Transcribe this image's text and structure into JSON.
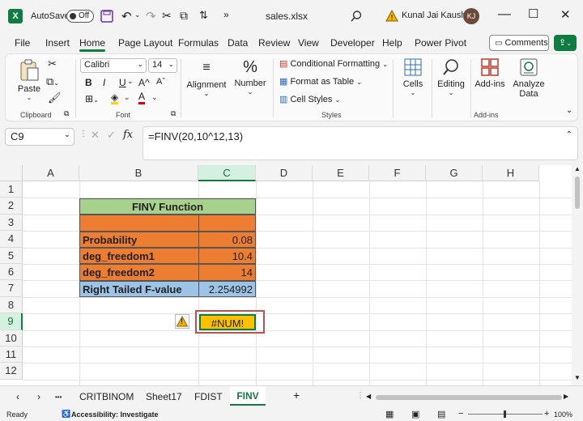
{
  "titlebar": {
    "app_icon": "excel-icon",
    "autosave_label": "AutoSave",
    "autosave_state": "Off",
    "filename": "sales.xlsx",
    "user_name": "Kunal Jai Kaushik",
    "user_initials": "KJ"
  },
  "menu_tabs": [
    "File",
    "Insert",
    "Home",
    "Page Layout",
    "Formulas",
    "Data",
    "Review",
    "View",
    "Developer",
    "Help",
    "Power Pivot"
  ],
  "active_tab": "Home",
  "comments_label": "Comments",
  "ribbon": {
    "paste_label": "Paste",
    "clipboard_label": "Clipboard",
    "font_name": "Calibri",
    "font_size": "14",
    "bold": "B",
    "italic": "I",
    "underline": "U",
    "font_label": "Font",
    "alignment_label": "Alignment",
    "number_label": "Number",
    "cond_format_label": "Conditional Formatting",
    "format_table_label": "Format as Table",
    "cell_styles_label": "Cell Styles",
    "styles_label": "Styles",
    "cells_label": "Cells",
    "editing_label": "Editing",
    "addins_label": "Add-ins",
    "analyze_label_1": "Analyze",
    "analyze_label_2": "Data",
    "addins_group_label": "Add-ins",
    "a_glyph": "A"
  },
  "formula_bar": {
    "name_box": "C9",
    "fx_label": "fx",
    "formula": "=FINV(20,10^12,13)"
  },
  "columns": [
    "A",
    "B",
    "C",
    "D",
    "E",
    "F",
    "G",
    "H"
  ],
  "rows": [
    "1",
    "2",
    "3",
    "4",
    "5",
    "6",
    "7",
    "8",
    "9",
    "10",
    "11",
    "12"
  ],
  "sheet": {
    "header": "FINV Function",
    "labels": [
      "Probability",
      "deg_freedom1",
      "deg_freedom2",
      "Right Tailed F-value"
    ],
    "values": [
      "0.08",
      "10.4",
      "14",
      "2.254992"
    ],
    "error_value": "#NUM!",
    "warning_glyph": "!"
  },
  "sheet_tabs": [
    "CRITBINOM",
    "Sheet17",
    "FDIST",
    "FINV"
  ],
  "active_sheet": "FINV",
  "ellipsis": "•••",
  "add_sheet": "+",
  "status": {
    "ready": "Ready",
    "accessibility": "Accessibility: Investigate",
    "zoom": "100%"
  },
  "colors": {
    "excel_green": "#107c41",
    "header_green": "#a9d18e",
    "orange_fill": "#ed7d31",
    "blue_fill": "#9dc3e6",
    "error_yellow": "#ffc000",
    "error_border": "#c00000"
  }
}
